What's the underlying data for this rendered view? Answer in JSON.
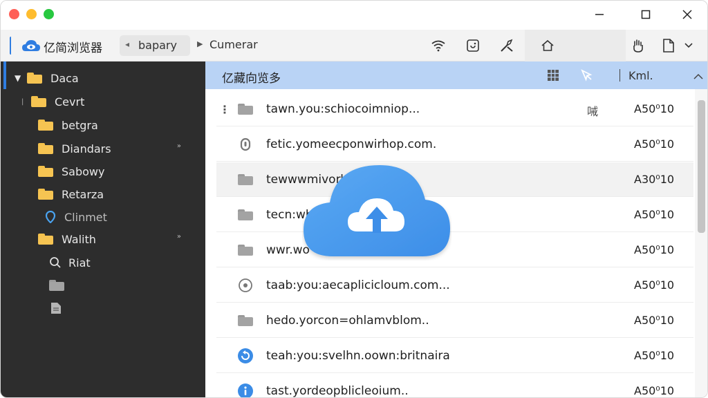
{
  "app": {
    "title": "亿简浏览器"
  },
  "toolbar": {
    "breadcrumb_chip": "bapary",
    "breadcrumb_current": "Cumerar",
    "icons": [
      "wifi-icon",
      "capture-icon",
      "tools-icon",
      "home-icon",
      "hand-icon",
      "document-icon",
      "chevron-down-icon"
    ]
  },
  "sidebar": {
    "items": [
      {
        "label": "Daca",
        "icon": "folder-icon",
        "expanded": true
      },
      {
        "label": "Cevrt",
        "icon": "folder-icon"
      },
      {
        "label": "betgra",
        "icon": "folder-icon"
      },
      {
        "label": "Diandars",
        "icon": "folder-icon",
        "chevron": "»"
      },
      {
        "label": "Sabowy",
        "icon": "folder-icon"
      },
      {
        "label": "Retarza",
        "icon": "folder-icon"
      },
      {
        "label": "Clinmet",
        "icon": "location-icon"
      },
      {
        "label": "Walith",
        "icon": "folder-icon",
        "chevron": "»"
      },
      {
        "label": "Riat",
        "icon": "search-icon"
      },
      {
        "label": "",
        "icon": "folder-icon"
      },
      {
        "label": "",
        "icon": "document-icon"
      }
    ]
  },
  "main": {
    "header_title": "亿藏向览多",
    "column_label": "Kml.",
    "rows": [
      {
        "name": "tawn.you:schiocoimniop...",
        "badge": "㖑",
        "size": "A50⁰10",
        "icon": "folder-icon"
      },
      {
        "name": "fetic.yomeecponwirhop.com.",
        "badge": "",
        "size": "A50⁰10",
        "icon": "shield-icon"
      },
      {
        "name": "tewwwmivorhol...",
        "badge": "",
        "size": "A30⁰10",
        "icon": "folder-icon"
      },
      {
        "name": "tecn:wh",
        "badge": "",
        "size": "A50⁰10",
        "icon": "folder-icon"
      },
      {
        "name": "wwr.wo",
        "badge": "",
        "size": "A50⁰10",
        "icon": "folder-icon"
      },
      {
        "name": "taab:you:aecaplicicloum.com...",
        "badge": "",
        "size": "A50⁰10",
        "icon": "clock-icon"
      },
      {
        "name": "hedo.yorcon=ohlamvblom..",
        "badge": "",
        "size": "A50⁰10",
        "icon": "folder-icon"
      },
      {
        "name": "teah:you:svelhn.oown:britnaira",
        "badge": "",
        "size": "A50⁰10",
        "icon": "refresh-icon"
      },
      {
        "name": "tast.yordeopblicleoium..",
        "badge": "",
        "size": "A50⁰10",
        "icon": "info-icon"
      }
    ]
  },
  "colors": {
    "accent": "#2f7de1",
    "sidebar_bg": "#2d2d2d",
    "header_bg": "#b9d3f5",
    "folder": "#f6c452",
    "cloud": "#4a9cf0"
  }
}
